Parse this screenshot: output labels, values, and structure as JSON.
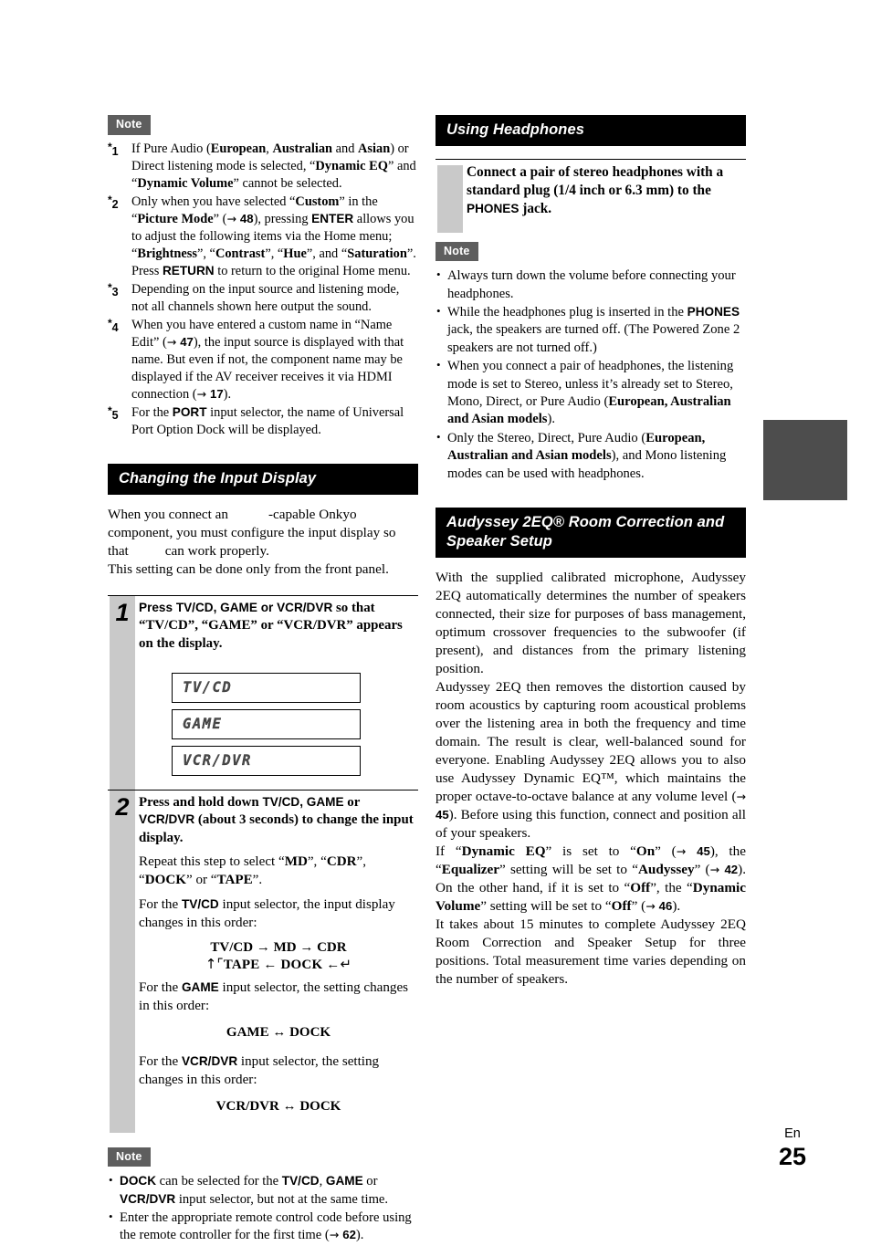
{
  "document": {
    "language_code": "En",
    "page_number": "25",
    "note_label": "Note"
  },
  "left_column": {
    "footnotes_note_label": "Note",
    "footnotes": [
      {
        "marker": "*1",
        "parts": [
          {
            "t": "If Pure Audio ("
          },
          {
            "t": "European",
            "b": true
          },
          {
            "t": ", "
          },
          {
            "t": "Australian",
            "b": true
          },
          {
            "t": " and "
          },
          {
            "t": "Asian",
            "b": true
          },
          {
            "t": ") or Direct listening mode is selected, “"
          },
          {
            "t": "Dynamic EQ",
            "b": true
          },
          {
            "t": "” and “"
          },
          {
            "t": "Dynamic Volume",
            "b": true
          },
          {
            "t": "” cannot be selected."
          }
        ]
      },
      {
        "marker": "*2",
        "parts": [
          {
            "t": "Only when you have selected “"
          },
          {
            "t": "Custom",
            "b": true
          },
          {
            "t": "” in the “"
          },
          {
            "t": "Picture Mode",
            "b": true
          },
          {
            "t": "” ("
          },
          {
            "t": "→ 48",
            "ref": true
          },
          {
            "t": "), pressing "
          },
          {
            "t": "ENTER",
            "sans": true
          },
          {
            "t": " allows you to adjust the following items via the Home menu; “"
          },
          {
            "t": "Brightness",
            "b": true
          },
          {
            "t": "”, “"
          },
          {
            "t": "Contrast",
            "b": true
          },
          {
            "t": "”, “"
          },
          {
            "t": "Hue",
            "b": true
          },
          {
            "t": "”, and “"
          },
          {
            "t": "Saturation",
            "b": true
          },
          {
            "t": "”. Press "
          },
          {
            "t": "RETURN",
            "sans": true
          },
          {
            "t": " to return to the original Home menu."
          }
        ]
      },
      {
        "marker": "*3",
        "parts": [
          {
            "t": "Depending on the input source and listening mode, not all channels shown here output the sound."
          }
        ]
      },
      {
        "marker": "*4",
        "parts": [
          {
            "t": "When you have entered a custom name in “Name Edit” ("
          },
          {
            "t": "→ 47",
            "ref": true
          },
          {
            "t": "), the input source is displayed with that name. But even if not, the component name may be displayed if the AV receiver receives it via HDMI connection ("
          },
          {
            "t": "→ 17",
            "ref": true
          },
          {
            "t": ")."
          }
        ]
      },
      {
        "marker": "*5",
        "parts": [
          {
            "t": "For the "
          },
          {
            "t": "PORT",
            "sans": true
          },
          {
            "t": " input selector, the name of Universal Port Option Dock will be displayed."
          }
        ]
      }
    ],
    "section": {
      "heading": "Changing the Input Display",
      "intro_line1_a": "When you connect an",
      "intro_line1_b": "-capable Onkyo component, you must configure the input display so that",
      "intro_line1_c": "can work properly.",
      "intro_line2": "This setting can be done only from the front panel."
    },
    "steps": [
      {
        "number": "1",
        "lead_parts": [
          {
            "t": "Press TV/CD, GAME or VCR/DVR",
            "sans": true
          },
          {
            "t": " so that “TV/CD”, “GAME” or “VCR/DVR” appears on the display."
          }
        ],
        "displays": [
          "TV/CD",
          "GAME",
          "VCR/DVR"
        ]
      },
      {
        "number": "2",
        "lead_parts": [
          {
            "t": "Press and hold down "
          },
          {
            "t": "TV/CD, GAME",
            "sans": true
          },
          {
            "t": " or "
          },
          {
            "t": "VCR/DVR",
            "sans": true
          },
          {
            "t": " (about 3 seconds) to change the input display."
          }
        ],
        "paragraphs": [
          {
            "parts": [
              {
                "t": "Repeat this step to select “"
              },
              {
                "t": "MD",
                "b": true
              },
              {
                "t": "”, “"
              },
              {
                "t": "CDR",
                "b": true
              },
              {
                "t": "”, “"
              },
              {
                "t": "DOCK",
                "b": true
              },
              {
                "t": "” or “"
              },
              {
                "t": "TAPE",
                "b": true
              },
              {
                "t": "”."
              }
            ]
          },
          {
            "parts": [
              {
                "t": "For the "
              },
              {
                "t": "TV/CD",
                "sans": true
              },
              {
                "t": " input selector, the input display changes in this order:"
              }
            ]
          }
        ],
        "flow_tvcd_row1": "TV/CD  →  MD  →  CDR",
        "flow_tvcd_row2": "TAPE ← DOCK ←",
        "para_game": [
          {
            "t": "For the "
          },
          {
            "t": "GAME",
            "sans": true
          },
          {
            "t": " input selector, the setting changes in this order:"
          }
        ],
        "flow_game": "GAME ↔ DOCK",
        "para_vcr": [
          {
            "t": "For the "
          },
          {
            "t": "VCR/DVR",
            "sans": true
          },
          {
            "t": " input selector, the setting changes in this order:"
          }
        ],
        "flow_vcr": "VCR/DVR ↔ DOCK"
      }
    ],
    "bottom_note_label": "Note",
    "bottom_notes": [
      {
        "parts": [
          {
            "t": "DOCK",
            "sans": true
          },
          {
            "t": " can be selected for the "
          },
          {
            "t": "TV/CD",
            "sans": true
          },
          {
            "t": ", "
          },
          {
            "t": "GAME",
            "sans": true
          },
          {
            "t": " or "
          },
          {
            "t": "VCR/DVR",
            "sans": true
          },
          {
            "t": " input selector, but not at the same time."
          }
        ]
      },
      {
        "parts": [
          {
            "t": "Enter the appropriate remote control code before using the remote controller for the first time ("
          },
          {
            "t": "→ 62",
            "ref": true
          },
          {
            "t": ")."
          }
        ]
      }
    ]
  },
  "right_column": {
    "headphones": {
      "heading": "Using Headphones",
      "callout_parts": [
        {
          "t": "Connect a pair of stereo headphones with a standard plug (1/4 inch or 6.3 mm) to the "
        },
        {
          "t": "PHONES",
          "sans": true
        },
        {
          "t": " jack."
        }
      ],
      "note_label": "Note",
      "notes": [
        {
          "parts": [
            {
              "t": "Always turn down the volume before connecting your headphones."
            }
          ]
        },
        {
          "parts": [
            {
              "t": "While the headphones plug is inserted in the "
            },
            {
              "t": "PHONES",
              "sans": true
            },
            {
              "t": " jack, the speakers are turned off. (The Powered Zone 2 speakers are not turned off.)"
            }
          ]
        },
        {
          "parts": [
            {
              "t": "When you connect a pair of headphones, the listening mode is set to Stereo, unless it’s already set to Stereo, Mono, Direct, or Pure Audio ("
            },
            {
              "t": "European, Australian and Asian models",
              "b": true
            },
            {
              "t": ")."
            }
          ]
        },
        {
          "parts": [
            {
              "t": "Only the Stereo, Direct, Pure Audio ("
            },
            {
              "t": "European, Australian and Asian models",
              "b": true
            },
            {
              "t": "), and Mono listening modes can be used with headphones."
            }
          ]
        }
      ]
    },
    "audyssey": {
      "heading": "Audyssey 2EQ® Room Correction and Speaker Setup",
      "paragraphs": [
        {
          "parts": [
            {
              "t": "With the supplied calibrated microphone, Audyssey 2EQ automatically determines the number of speakers connected, their size for purposes of bass management, optimum crossover frequencies to the subwoofer (if present), and distances from the primary listening position."
            }
          ]
        },
        {
          "parts": [
            {
              "t": "Audyssey 2EQ then removes the distortion caused by room acoustics by capturing room acoustical problems over the listening area in both the frequency and time domain. The result is clear, well-balanced sound for everyone. Enabling Audyssey 2EQ allows you to also use Audyssey Dynamic EQ™, which maintains the proper octave-to-octave balance at any volume level ("
            },
            {
              "t": "→ 45",
              "ref": true
            },
            {
              "t": "). Before using this function, connect and position all of your speakers."
            }
          ]
        },
        {
          "parts": [
            {
              "t": "If “"
            },
            {
              "t": "Dynamic EQ",
              "b": true
            },
            {
              "t": "” is set to “"
            },
            {
              "t": "On",
              "b": true
            },
            {
              "t": "” ("
            },
            {
              "t": "→ 45",
              "ref": true
            },
            {
              "t": "), the “"
            },
            {
              "t": "Equalizer",
              "b": true
            },
            {
              "t": "” setting will be set to “"
            },
            {
              "t": "Audyssey",
              "b": true
            },
            {
              "t": "” ("
            },
            {
              "t": "→ 42",
              "ref": true
            },
            {
              "t": "). On the other hand, if it is set to “"
            },
            {
              "t": "Off",
              "b": true
            },
            {
              "t": "”, the “"
            },
            {
              "t": "Dynamic Volume",
              "b": true
            },
            {
              "t": "” setting will be set to “"
            },
            {
              "t": "Off",
              "b": true
            },
            {
              "t": "” ("
            },
            {
              "t": "→ 46",
              "ref": true
            },
            {
              "t": ")."
            }
          ]
        },
        {
          "parts": [
            {
              "t": "It takes about 15 minutes to complete Audyssey 2EQ Room Correction and Speaker Setup for three positions. Total measurement time varies depending on the number of speakers."
            }
          ]
        }
      ]
    }
  },
  "colors": {
    "header_bg": "#000000",
    "note_badge_bg": "#5e5e5e",
    "rail_gray": "#c9c9c9",
    "tab_marker": "#4d4d4d"
  }
}
